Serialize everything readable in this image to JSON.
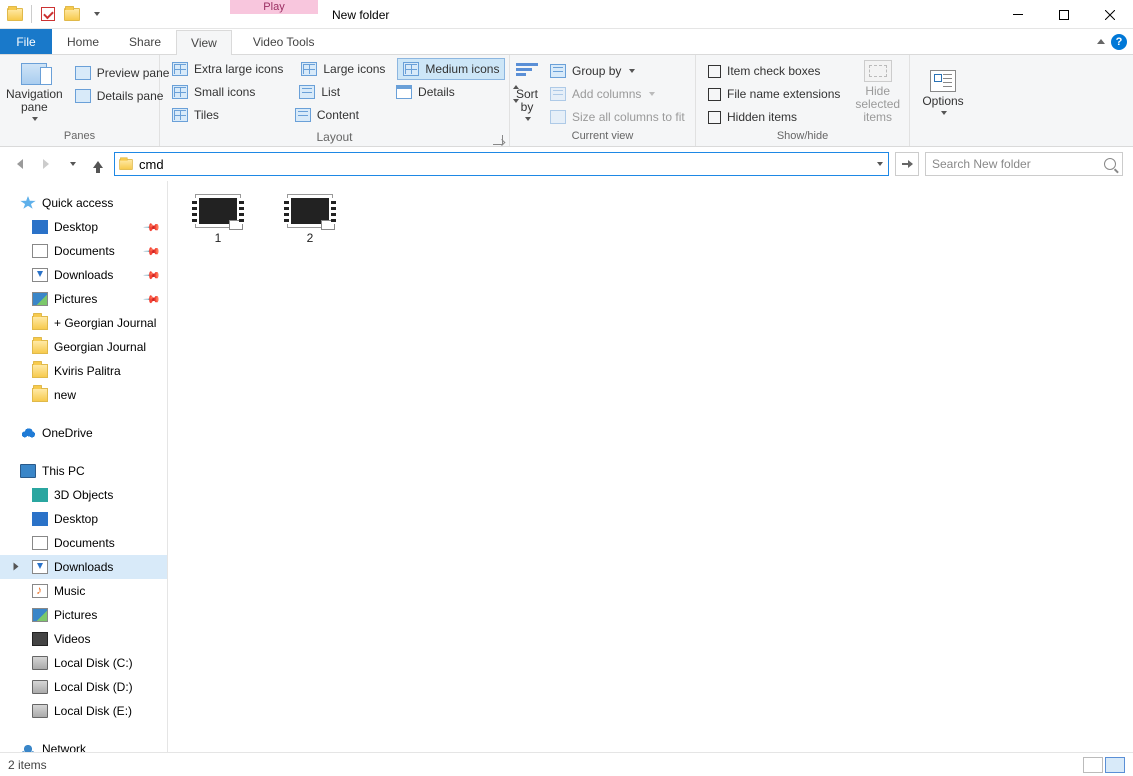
{
  "window": {
    "title": "New folder",
    "context_tab_heading": "Play",
    "context_tab_label": "Video Tools"
  },
  "tabs": {
    "file": "File",
    "items": [
      "Home",
      "Share",
      "View"
    ],
    "active": "View"
  },
  "ribbon": {
    "panes": {
      "label": "Panes",
      "navigation_pane": "Navigation\npane",
      "preview_pane": "Preview pane",
      "details_pane": "Details pane"
    },
    "layout": {
      "label": "Layout",
      "extra_large": "Extra large icons",
      "large": "Large icons",
      "medium": "Medium icons",
      "small": "Small icons",
      "list": "List",
      "details": "Details",
      "tiles": "Tiles",
      "content": "Content"
    },
    "current_view": {
      "label": "Current view",
      "sort_by": "Sort\nby",
      "group_by": "Group by",
      "add_columns": "Add columns",
      "size_all": "Size all columns to fit"
    },
    "show_hide": {
      "label": "Show/hide",
      "item_check": "Item check boxes",
      "file_ext": "File name extensions",
      "hidden": "Hidden items",
      "hide_selected": "Hide selected\nitems"
    },
    "options": {
      "label": "Options"
    }
  },
  "address": {
    "value": "cmd"
  },
  "search": {
    "placeholder": "Search New folder"
  },
  "tree": {
    "quick_access": {
      "label": "Quick access",
      "items": [
        {
          "label": "Desktop",
          "icon": "desktop",
          "pinned": true
        },
        {
          "label": "Documents",
          "icon": "doc",
          "pinned": true
        },
        {
          "label": "Downloads",
          "icon": "down",
          "pinned": true
        },
        {
          "label": "Pictures",
          "icon": "pic",
          "pinned": true
        },
        {
          "label": "+ Georgian Journal",
          "icon": "folder",
          "pinned": false
        },
        {
          "label": "Georgian Journal",
          "icon": "folder",
          "pinned": false
        },
        {
          "label": "Kviris Palitra",
          "icon": "folder",
          "pinned": false
        },
        {
          "label": "new",
          "icon": "folder",
          "pinned": false
        }
      ]
    },
    "onedrive": "OneDrive",
    "this_pc": {
      "label": "This PC",
      "items": [
        {
          "label": "3D Objects",
          "icon": "obj"
        },
        {
          "label": "Desktop",
          "icon": "desktop"
        },
        {
          "label": "Documents",
          "icon": "doc"
        },
        {
          "label": "Downloads",
          "icon": "down",
          "selected": true
        },
        {
          "label": "Music",
          "icon": "music"
        },
        {
          "label": "Pictures",
          "icon": "pic"
        },
        {
          "label": "Videos",
          "icon": "video"
        },
        {
          "label": "Local Disk (C:)",
          "icon": "disk"
        },
        {
          "label": "Local Disk (D:)",
          "icon": "disk"
        },
        {
          "label": "Local Disk (E:)",
          "icon": "disk"
        }
      ]
    },
    "network": "Network"
  },
  "files": [
    {
      "name": "1"
    },
    {
      "name": "2"
    }
  ],
  "status": {
    "text": "2 items"
  }
}
